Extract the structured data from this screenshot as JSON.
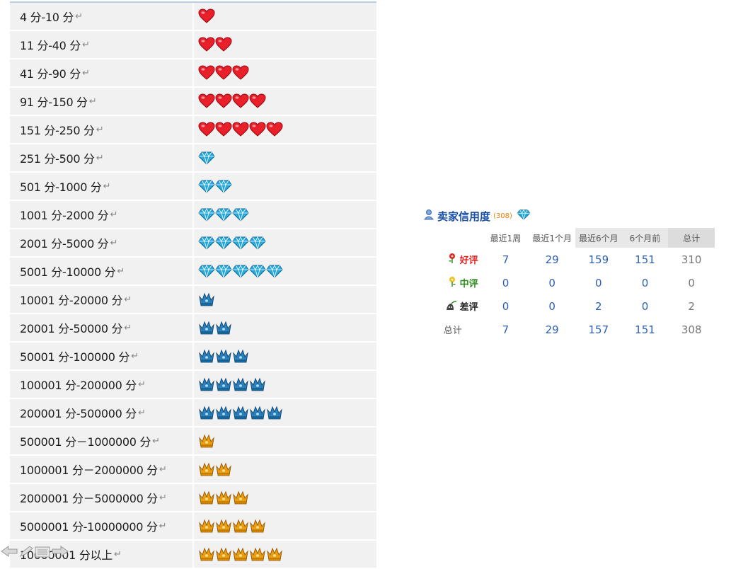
{
  "levels": [
    {
      "range": "4 分-10 分",
      "icon": "heart",
      "count": 1
    },
    {
      "range": "11 分-40 分",
      "icon": "heart",
      "count": 2
    },
    {
      "range": "41 分-90 分",
      "icon": "heart",
      "count": 3
    },
    {
      "range": "91 分-150 分",
      "icon": "heart",
      "count": 4
    },
    {
      "range": "151 分-250 分",
      "icon": "heart",
      "count": 5
    },
    {
      "range": "251 分-500 分",
      "icon": "diamond",
      "count": 1
    },
    {
      "range": "501 分-1000 分",
      "icon": "diamond",
      "count": 2
    },
    {
      "range": "1001 分-2000 分",
      "icon": "diamond",
      "count": 3
    },
    {
      "range": "2001 分-5000 分",
      "icon": "diamond",
      "count": 4
    },
    {
      "range": "5001 分-10000 分",
      "icon": "diamond",
      "count": 5
    },
    {
      "range": "10001 分-20000 分",
      "icon": "blue-crown",
      "count": 1
    },
    {
      "range": "20001 分-50000 分",
      "icon": "blue-crown",
      "count": 2
    },
    {
      "range": "50001 分-100000 分",
      "icon": "blue-crown",
      "count": 3
    },
    {
      "range": "100001 分-200000 分",
      "icon": "blue-crown",
      "count": 4
    },
    {
      "range": "200001 分-500000 分",
      "icon": "blue-crown",
      "count": 5
    },
    {
      "range": "500001 分－1000000 分",
      "icon": "gold-crown",
      "count": 1
    },
    {
      "range": "1000001 分－2000000 分",
      "icon": "gold-crown",
      "count": 2
    },
    {
      "range": "2000001 分－5000000 分",
      "icon": "gold-crown",
      "count": 3
    },
    {
      "range": "5000001 分-10000000 分",
      "icon": "gold-crown",
      "count": 4
    },
    {
      "range": "10000001 分以上",
      "icon": "gold-crown",
      "count": 5
    }
  ],
  "return_mark": "↵",
  "credit": {
    "title": "卖家信用度",
    "score": "(308)",
    "icon": "diamond",
    "columns": [
      "最近1周",
      "最近1个月",
      "最近6个月",
      "6个月前",
      "总计"
    ],
    "rows": [
      {
        "label": "好评",
        "icon": "red-flower-icon",
        "color": "#e52020",
        "values": [
          "7",
          "29",
          "159",
          "151",
          "310"
        ]
      },
      {
        "label": "中评",
        "icon": "yellow-flower-icon",
        "color": "#2a8a1a",
        "values": [
          "0",
          "0",
          "0",
          "0",
          "0"
        ]
      },
      {
        "label": "差评",
        "icon": "dead-plant-icon",
        "color": "#222222",
        "values": [
          "0",
          "0",
          "2",
          "0",
          "2"
        ]
      },
      {
        "label": "总计",
        "icon": "",
        "color": "#555555",
        "values": [
          "7",
          "29",
          "157",
          "151",
          "308"
        ]
      }
    ]
  },
  "colors": {
    "heart": "#e8202a",
    "diamond": "#2aa8d8",
    "blue_crown": "#2a80b8",
    "gold_crown": "#e8a010",
    "link_blue": "#2b5fb4",
    "score_orange": "#f08000"
  }
}
